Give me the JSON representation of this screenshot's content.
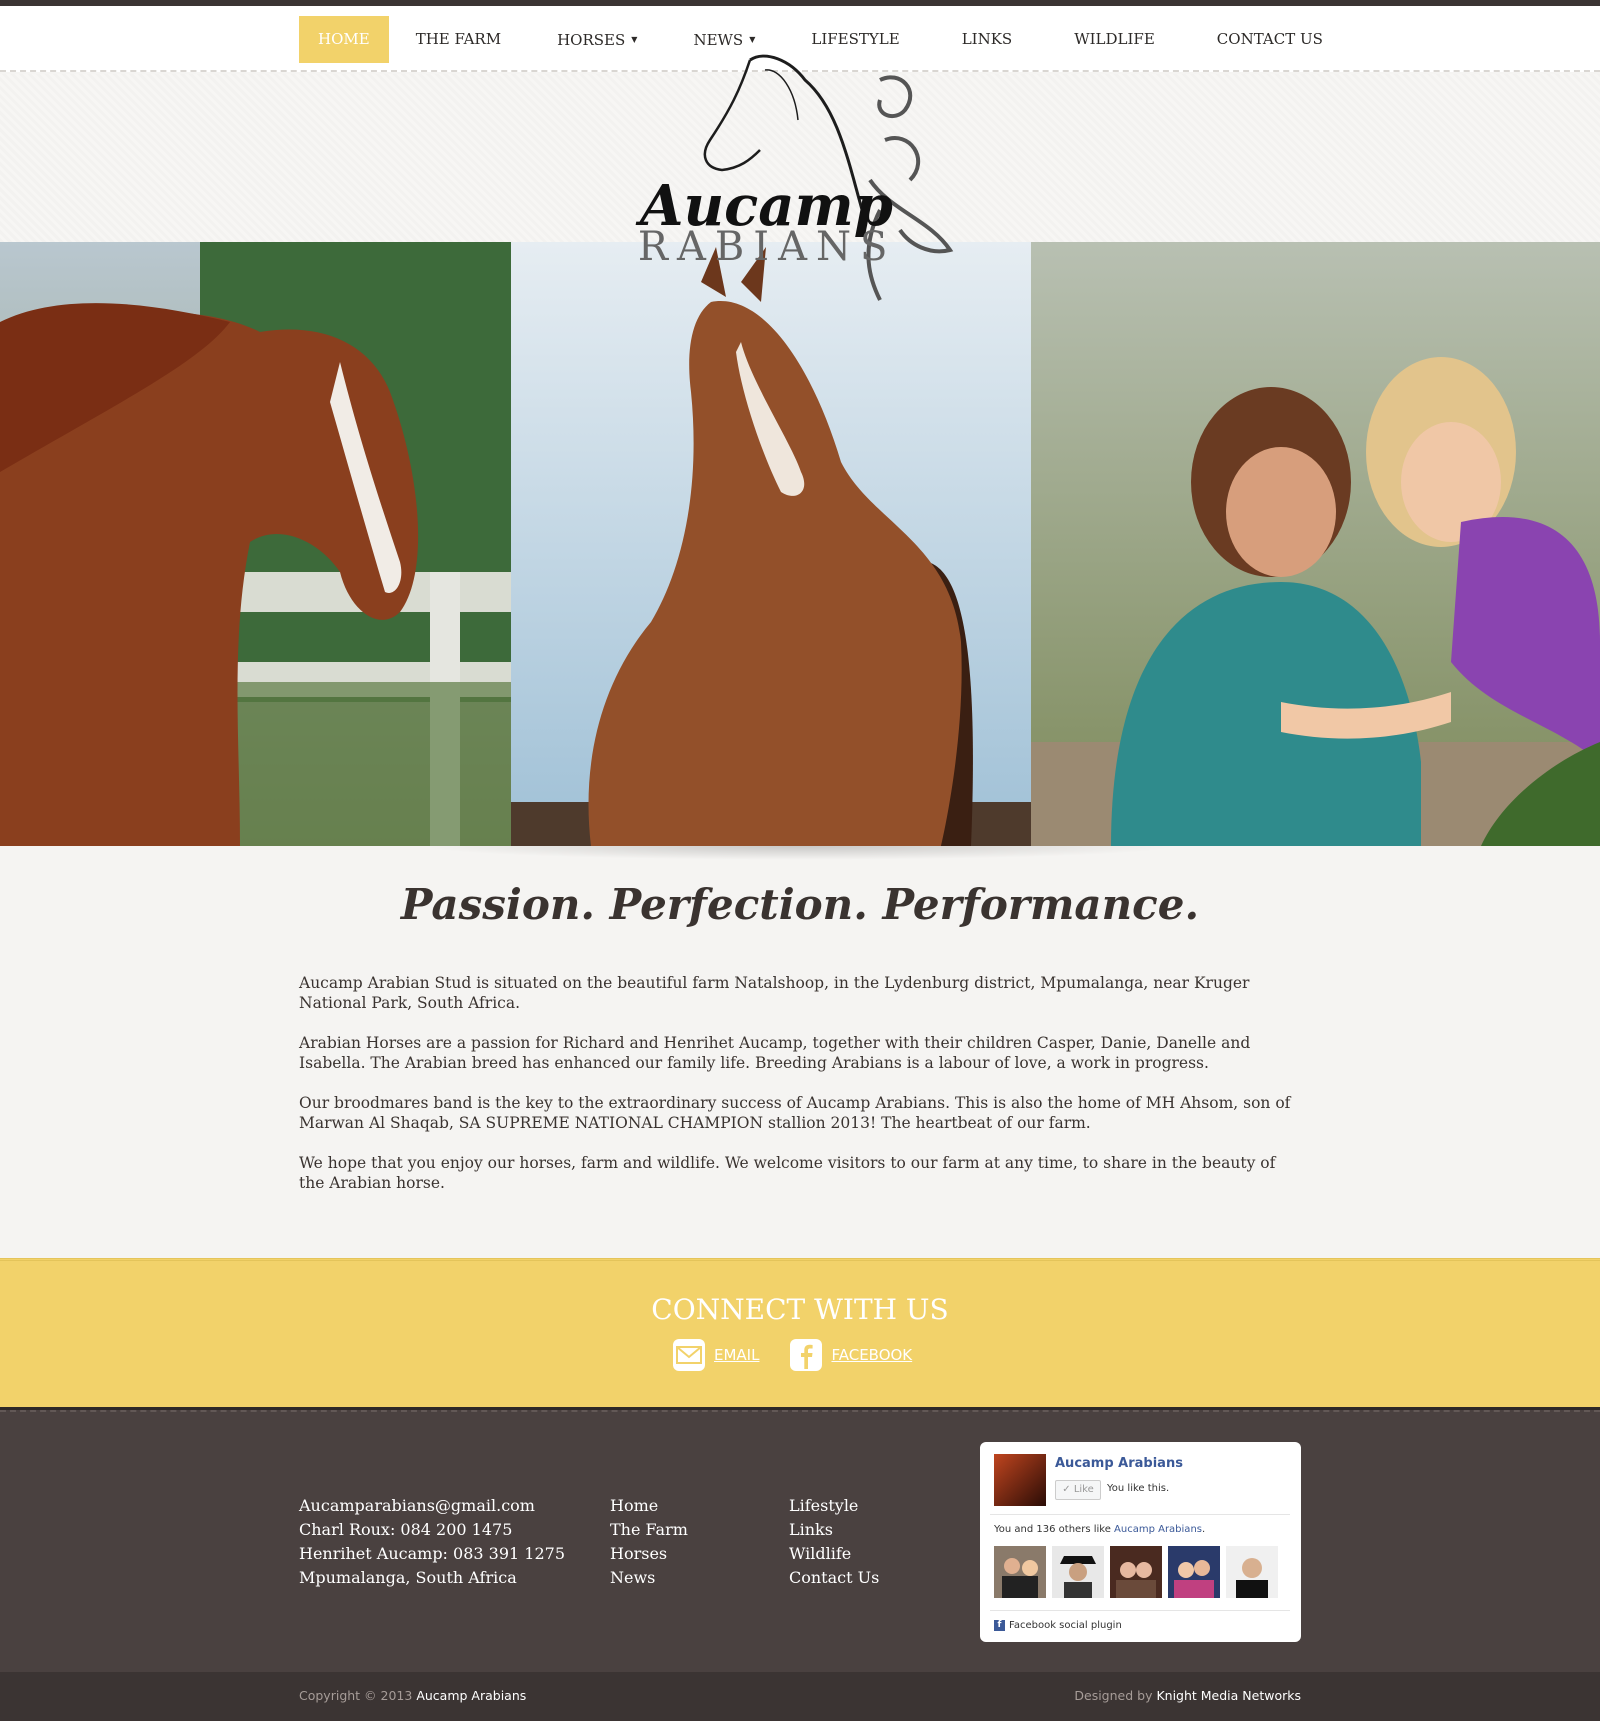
{
  "nav": {
    "items": [
      {
        "label": "HOME",
        "active": true,
        "has_dropdown": false
      },
      {
        "label": "THE FARM",
        "active": false,
        "has_dropdown": false
      },
      {
        "label": "HORSES",
        "active": false,
        "has_dropdown": true
      },
      {
        "label": "NEWS",
        "active": false,
        "has_dropdown": true
      },
      {
        "label": "LIFESTYLE",
        "active": false,
        "has_dropdown": false
      },
      {
        "label": "LINKS",
        "active": false,
        "has_dropdown": false
      },
      {
        "label": "WILDLIFE",
        "active": false,
        "has_dropdown": false
      },
      {
        "label": "CONTACT US",
        "active": false,
        "has_dropdown": false
      }
    ]
  },
  "logo": {
    "script": "Aucamp",
    "word": "ARABIANS"
  },
  "tagline": "Passion. Perfection. Performance.",
  "intro": {
    "paragraphs": [
      "Aucamp Arabian Stud is situated on the beautiful farm Natalshoop, in the Lydenburg district, Mpumalanga, near Kruger National Park, South Africa.",
      "Arabian Horses are a passion for Richard and Henrihet Aucamp, together with their children Casper, Danie, Danelle and Isabella. The Arabian breed has enhanced our family life. Breeding Arabians is a labour of love, a work in progress.",
      "Our broodmares band is the key to the extraordinary success of Aucamp Arabians. This is also the home of MH Ahsom, son of Marwan Al Shaqab, SA SUPREME NATIONAL CHAMPION stallion 2013! The heartbeat of our farm.",
      "We hope that you enjoy our horses, farm and wildlife. We welcome visitors to our farm at any time, to share in the beauty of the Arabian horse."
    ]
  },
  "connect": {
    "title": "CONNECT WITH US",
    "email_label": "EMAIL",
    "facebook_label": "FACEBOOK"
  },
  "footer": {
    "contact": [
      "Aucamparabians@gmail.com",
      "Charl Roux: 084 200 1475",
      "Henrihet Aucamp: 083 391 1275",
      "Mpumalanga, South Africa"
    ],
    "links_col1": [
      "Home",
      "The Farm",
      "Horses",
      "News"
    ],
    "links_col2": [
      "Lifestyle",
      "Links",
      "Wildlife",
      "Contact Us"
    ],
    "facebook_box": {
      "page_name": "Aucamp Arabians",
      "like_label": "Like",
      "you_like": "You like this.",
      "others_prefix": "You and 136 others like ",
      "others_page": "Aucamp Arabians",
      "others_suffix": ".",
      "plugin_label": "Facebook social plugin"
    }
  },
  "bottom": {
    "copyright_prefix": "Copyright © 2013",
    "copyright_name": "Aucamp Arabians",
    "designed_prefix": "Designed by",
    "designed_name": "Knight Media Networks"
  },
  "colors": {
    "accent": "#f2d26a",
    "dark": "#3b3433",
    "footer": "#4a4140"
  }
}
